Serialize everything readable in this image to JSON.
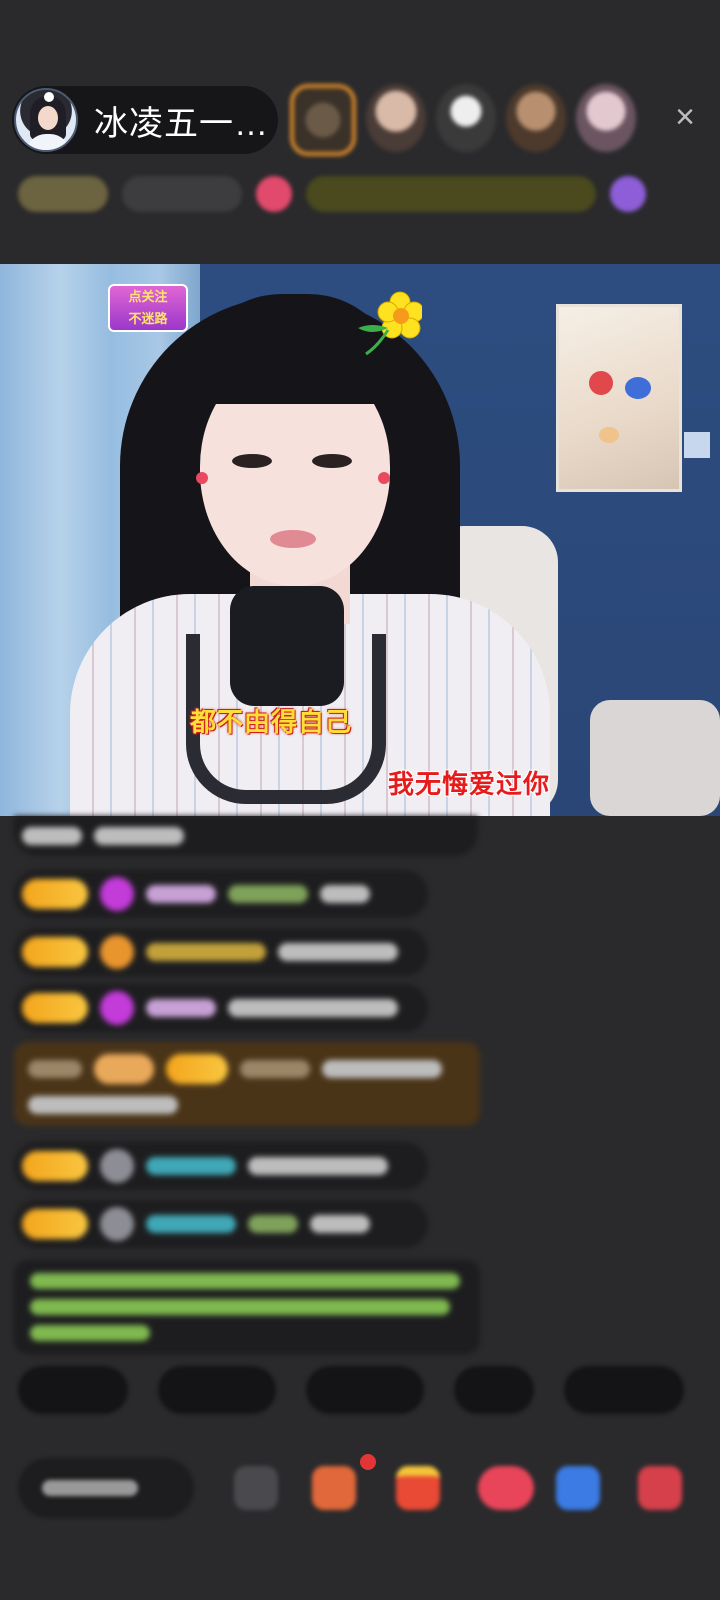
{
  "host": {
    "name": "冰凌五一…",
    "avatar_icon": "host-avatar"
  },
  "header": {
    "viewer_icons": [
      "viewer-avatar",
      "viewer-avatar",
      "viewer-avatar",
      "viewer-avatar",
      "viewer-avatar"
    ],
    "close_icon": "×"
  },
  "video": {
    "lyric_line_1": "都不由得自己",
    "lyric_line_2": "我无悔爱过你",
    "follow_sticker_lines": [
      "点关注",
      "不迷路"
    ]
  },
  "colors": {
    "background": "#2a2a2c",
    "level_badge": "#f3a51c",
    "lyric_yellow": "#ffde3a",
    "lyric_red": "#e61c1c"
  }
}
